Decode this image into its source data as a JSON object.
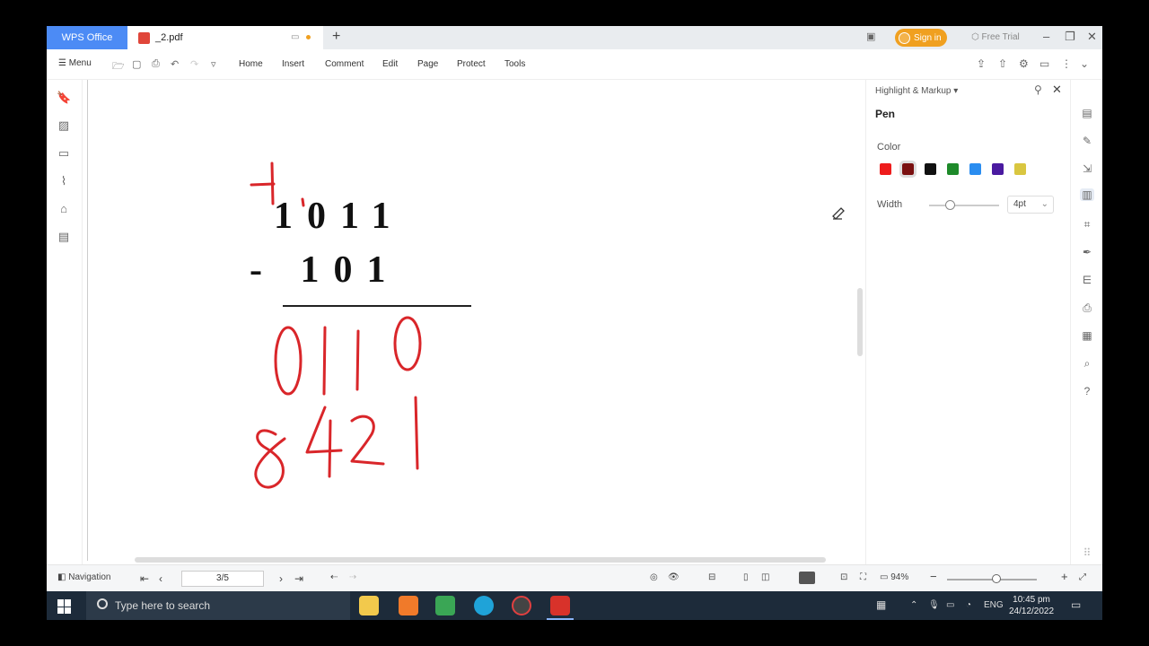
{
  "titlebar": {
    "app_tab": "WPS Office",
    "doc_tab": "_2.pdf",
    "sign_in": "Sign in",
    "free_trial": "Free Trial"
  },
  "menubar": {
    "menu_label": "Menu",
    "tabs": [
      "Home",
      "Insert",
      "Comment",
      "Edit",
      "Page",
      "Protect",
      "Tools"
    ]
  },
  "document": {
    "typed_line_1": "1011",
    "typed_line_2": "- 101",
    "handwritten_result": "0110",
    "handwritten_weights": "8421",
    "handwritten_carry": "1",
    "pen_color": "#d9262a"
  },
  "panel": {
    "title": "Highlight & Markup",
    "tool": "Pen",
    "color_label": "Color",
    "colors": [
      "#ee1c1c",
      "#7a1010",
      "#111111",
      "#1e8a2a",
      "#2a8df0",
      "#4a1aa0",
      "#d9c640"
    ],
    "selected_color_index": 1,
    "width_label": "Width",
    "width_value": "4pt",
    "width_level": 0.3
  },
  "statusbar": {
    "navigation": "Navigation",
    "page_indicator": "3/5",
    "zoom": "94%",
    "zoom_level": 0.55
  },
  "taskbar": {
    "search_placeholder": "Type here to search",
    "language": "ENG",
    "time": "10:45 pm",
    "date": "24/12/2022"
  }
}
